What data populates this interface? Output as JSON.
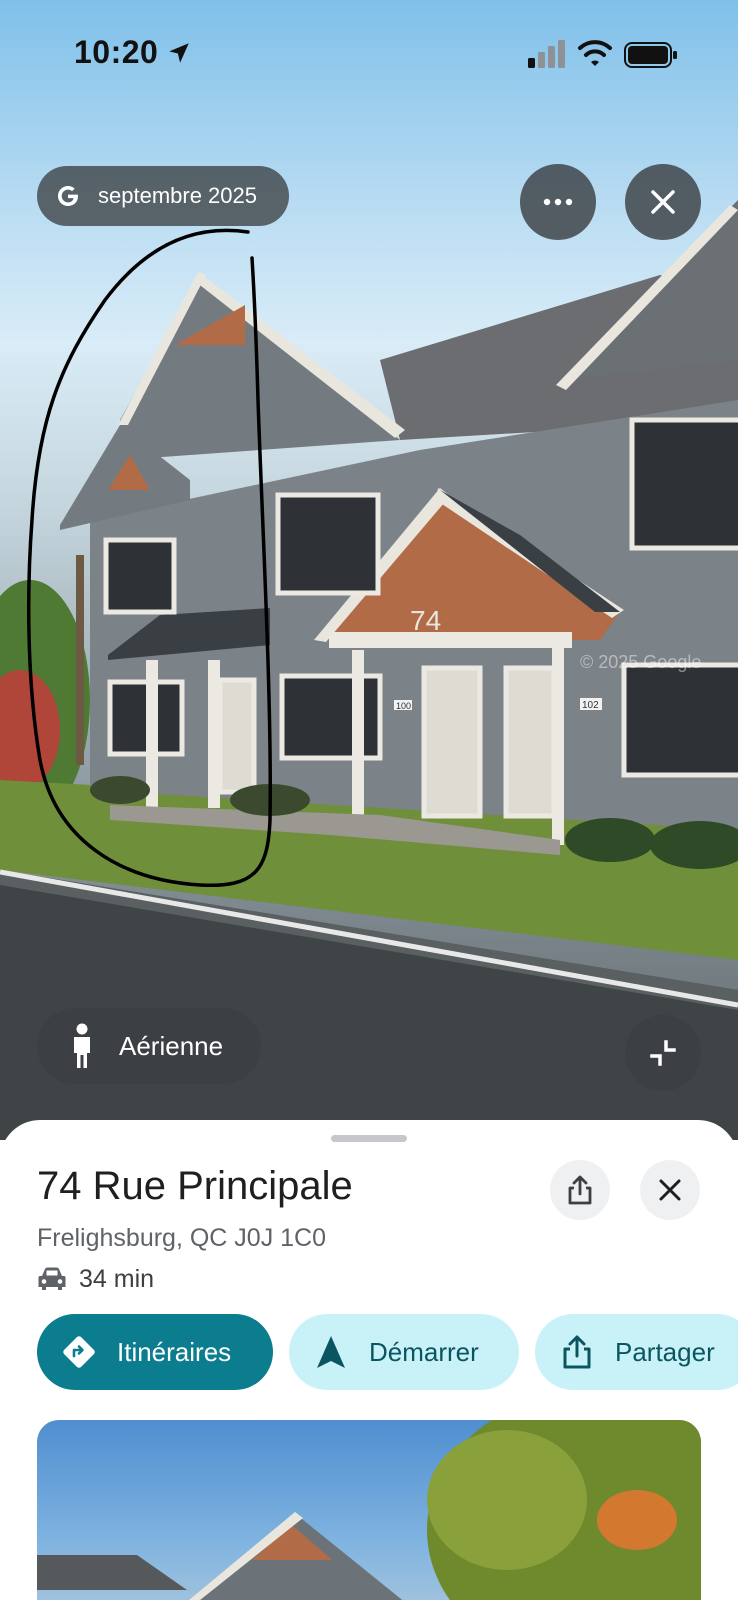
{
  "status_bar": {
    "time": "10:20",
    "icons": [
      "location-arrow-icon",
      "cellular-signal-icon",
      "wifi-icon",
      "battery-icon"
    ]
  },
  "street_view": {
    "date_label": "septembre 2025",
    "date_icon": "google-g-icon",
    "more_icon": "more-horizontal-icon",
    "close_icon": "close-icon",
    "aerial_label": "Aérienne",
    "aerial_icon": "pegman-icon",
    "minimize_icon": "collapse-icon",
    "house_number": "74",
    "door_numbers": [
      "100",
      "102"
    ],
    "watermark": "© 2025 Google",
    "annotation_color": "#000000"
  },
  "place": {
    "title": "74 Rue Principale",
    "address": "Frelighsburg, QC J0J 1C0",
    "travel_mode_icon": "car-icon",
    "travel_time": "34 min",
    "share_icon": "share-icon",
    "close_icon": "close-icon"
  },
  "actions": {
    "directions": {
      "label": "Itinéraires",
      "icon": "directions-icon"
    },
    "start": {
      "label": "Démarrer",
      "icon": "navigation-arrow-icon"
    },
    "share": {
      "label": "Partager",
      "icon": "share-icon"
    }
  },
  "colors": {
    "primary": "#0b7d8e",
    "secondary_bg": "#c9f2f8",
    "secondary_text": "#0b5561",
    "chip_bg": "#3c4043"
  }
}
